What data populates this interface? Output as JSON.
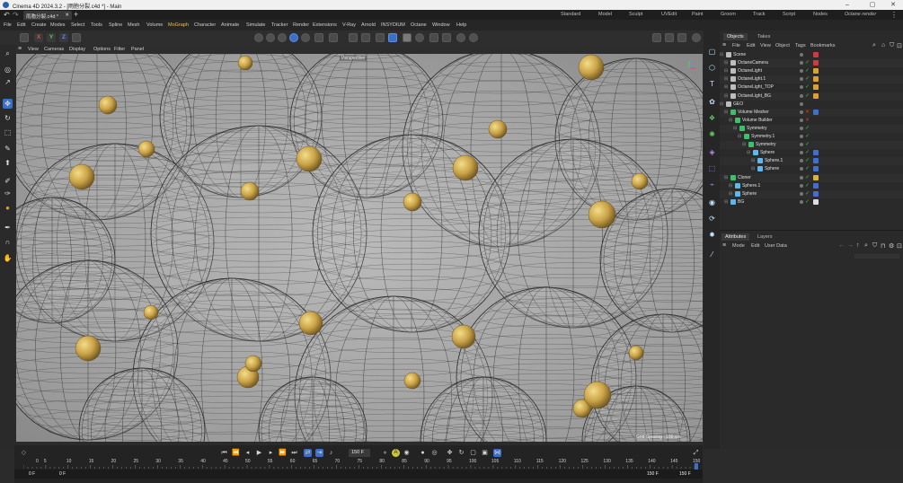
{
  "window": {
    "title": "Cinema 4D 2024.3.2 - [雨胞分裂.c4d *] - Main"
  },
  "tabs": {
    "document": "雨胞分裂.c4d *",
    "add": "+"
  },
  "layouts": [
    "Standard",
    "Model",
    "Sculpt",
    "UVEdit",
    "Paint",
    "Groom",
    "Track",
    "Script",
    "Nodes",
    "Octane render"
  ],
  "menu": [
    "File",
    "Edit",
    "Create",
    "Modes",
    "Select",
    "Tools",
    "Spline",
    "Mesh",
    "Volume",
    "MoGraph",
    "Character",
    "Animate",
    "Simulate",
    "Tracker",
    "Render",
    "Extensions",
    "V-Ray",
    "Arnold",
    "INSYDIUM",
    "Octane",
    "Window",
    "Help"
  ],
  "menu_active": "MoGraph",
  "toolbar": {
    "x": "X",
    "y": "Y",
    "z": "Z"
  },
  "viewport_menu": [
    "View",
    "Cameras",
    "Display",
    "Options",
    "Filter",
    "Panel"
  ],
  "viewport": {
    "label": "Perspective",
    "grid_info": "Grid Spacing : 100 cm"
  },
  "object_panel": {
    "tabs": [
      "Objects",
      "Takes"
    ],
    "menu": [
      "File",
      "Edit",
      "View",
      "Object",
      "Tags",
      "Bookmarks"
    ],
    "rows": [
      {
        "name": "Scene",
        "indent": 0,
        "icon": "#bdbdbd",
        "check": "",
        "tag": "#d23b3b"
      },
      {
        "name": "OctaneCamera",
        "indent": 1,
        "icon": "#bdbdbd",
        "check": "#35c23b",
        "tag": "#d23b3b"
      },
      {
        "name": "OctaneLight",
        "indent": 1,
        "icon": "#bdbdbd",
        "check": "#35c23b",
        "tag": "#e0a030"
      },
      {
        "name": "OctaneLight.1",
        "indent": 1,
        "icon": "#bdbdbd",
        "check": "#35c23b",
        "tag": "#e0a030"
      },
      {
        "name": "OctaneLight_TOP",
        "indent": 1,
        "icon": "#bdbdbd",
        "check": "#35c23b",
        "tag": "#e0a030"
      },
      {
        "name": "OctaneLight_BG",
        "indent": 1,
        "icon": "#bdbdbd",
        "check": "#35c23b",
        "tag": "#e0a030"
      },
      {
        "name": "GEO",
        "indent": 0,
        "icon": "#bdbdbd",
        "check": "",
        "tag": ""
      },
      {
        "name": "Volume Mesher",
        "indent": 1,
        "icon": "#3cc06a",
        "check": "#d23b3b",
        "tag": "#3f6fd0"
      },
      {
        "name": "Volume Builder",
        "indent": 2,
        "icon": "#3cc06a",
        "check": "#d23b3b",
        "tag": ""
      },
      {
        "name": "Symmetry",
        "indent": 3,
        "icon": "#3cc06a",
        "check": "#35c23b",
        "tag": ""
      },
      {
        "name": "Symmetry.1",
        "indent": 4,
        "icon": "#3cc06a",
        "check": "#35c23b",
        "tag": ""
      },
      {
        "name": "Symmetry",
        "indent": 5,
        "icon": "#3cc06a",
        "check": "#35c23b",
        "tag": ""
      },
      {
        "name": "Sphere",
        "indent": 6,
        "icon": "#5fb7ee",
        "check": "#35c23b",
        "tag": "#3f6fd0"
      },
      {
        "name": "Sphere.1",
        "indent": 7,
        "icon": "#5fb7ee",
        "check": "#35c23b",
        "tag": "#3f6fd0"
      },
      {
        "name": "Sphere",
        "indent": 7,
        "icon": "#5fb7ee",
        "check": "#35c23b",
        "tag": "#3f6fd0"
      },
      {
        "name": "Cloner",
        "indent": 1,
        "icon": "#3cc06a",
        "check": "#35c23b",
        "tag": "#e0b030"
      },
      {
        "name": "Sphere.1",
        "indent": 2,
        "icon": "#5fb7ee",
        "check": "#35c23b",
        "tag": "#3f6fd0"
      },
      {
        "name": "Sphere",
        "indent": 2,
        "icon": "#5fb7ee",
        "check": "#35c23b",
        "tag": "#3f6fd0"
      },
      {
        "name": "BG",
        "indent": 1,
        "icon": "#5fb7ee",
        "check": "#35c23b",
        "tag": "#dddddd"
      }
    ]
  },
  "attributes_panel": {
    "tabs": [
      "Attributes",
      "Layers"
    ],
    "menu": [
      "Mode",
      "Edit",
      "User Data"
    ]
  },
  "timeline": {
    "ticks": [
      "0",
      "5",
      "10",
      "15",
      "20",
      "25",
      "30",
      "35",
      "40",
      "45",
      "50",
      "55",
      "60",
      "65",
      "70",
      "75",
      "80",
      "85",
      "90",
      "95",
      "100",
      "105",
      "110",
      "115",
      "120",
      "125",
      "130",
      "135",
      "140",
      "145",
      "150"
    ],
    "current_frame": "150 F",
    "start_field": "0 F",
    "start_field2": "0 F",
    "end_field": "150 F",
    "end_field2": "150 F"
  }
}
